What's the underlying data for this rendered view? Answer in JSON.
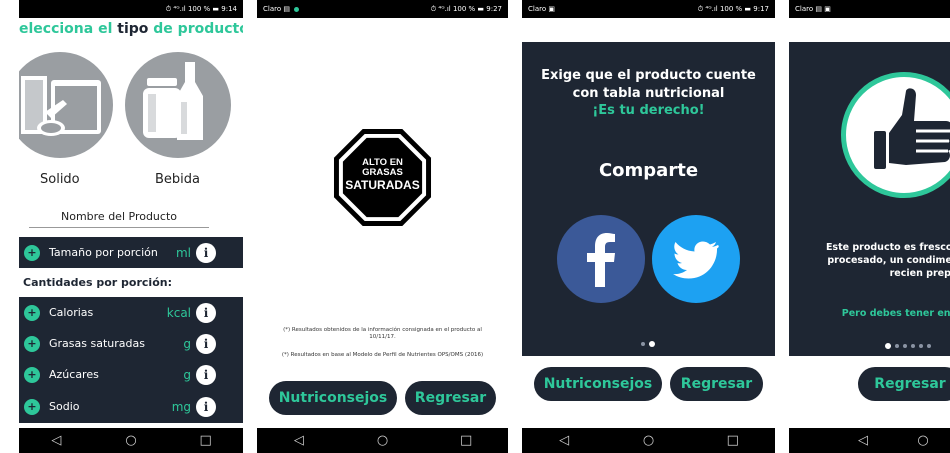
{
  "screens": {
    "s1": {
      "status": {
        "right": "⏱ ⁴ᴳ.ıl 100 % ▬ 9:14"
      },
      "title_parts": [
        "elecciona el ",
        "tipo",
        " de producto"
      ],
      "types": [
        {
          "label": "Solido",
          "icon": "cans-icon"
        },
        {
          "label": "Bebida",
          "icon": "bottles-icon"
        }
      ],
      "name_label": "Nombre del Producto",
      "serving": {
        "label": "Tamaño por porción",
        "unit": "ml"
      },
      "amounts_heading": "Cantidades por porción:",
      "rows": [
        {
          "label": "Calorias",
          "unit": "kcal"
        },
        {
          "label": "Grasas saturadas",
          "unit": "g"
        },
        {
          "label": "Azúcares",
          "unit": "g"
        },
        {
          "label": "Sodio",
          "unit": "mg"
        }
      ]
    },
    "s2": {
      "status": {
        "left": "Claro ▤",
        "right": "⏱ ⁴ᴳ.ıl 100 % ▬ 9:27"
      },
      "seal": {
        "line1": "ALTO EN",
        "line2": "GRASAS",
        "line3": "SATURADAS"
      },
      "footnote1": "(*) Resultados obtenidos de la información consignada en el producto al 10/11/17.",
      "footnote2": "(*) Resultados en base al Modelo de Perfil de Nutrientes OPS/OMS (2016)",
      "btn_tips": "Nutriconsejos",
      "btn_back": "Regresar"
    },
    "s3": {
      "status": {
        "left": "Claro ▣",
        "right": "⏱ ⁴ᴳ.ıl 100 % ▬ 9:17"
      },
      "line1": "Exige que el producto cuente",
      "line2": "con tabla nutricional",
      "line3": "¡Es tu derecho!",
      "share": "Comparte",
      "btn_tips": "Nutriconsejos",
      "btn_back": "Regresar"
    },
    "s4": {
      "status": {
        "left": "Claro ▤ ▣"
      },
      "line1": "Este producto es fresco, ",
      "line2": "procesado, un condimen",
      "line3": "recien prepara",
      "line4": "Pero debes tener en cu",
      "btn_back": "Regresar"
    }
  },
  "nav": {
    "back": "◁",
    "home": "○",
    "recent": "□"
  },
  "colors": {
    "accent": "#2ec79a",
    "panel": "#1e2633",
    "facebook": "#3b5998",
    "twitter": "#1da1f2"
  }
}
